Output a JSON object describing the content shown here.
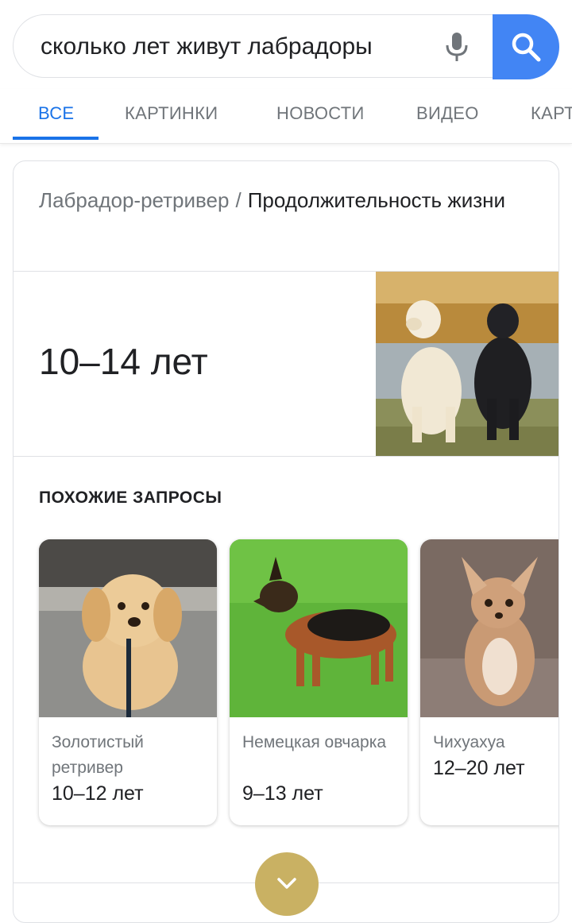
{
  "search": {
    "query": "сколько лет живут лабрадоры",
    "icons": {
      "mic": "mic-icon",
      "search": "search-icon"
    },
    "accent": "#4285f4"
  },
  "tabs": [
    {
      "label": "ВСЕ",
      "active": true
    },
    {
      "label": "КАРТИНКИ",
      "active": false
    },
    {
      "label": "НОВОСТИ",
      "active": false
    },
    {
      "label": "ВИДЕО",
      "active": false
    },
    {
      "label": "КАРТЫ",
      "active": false
    }
  ],
  "answer": {
    "breadcrumb_parent": "Лабрадор-ретривер",
    "breadcrumb_separator": "/",
    "breadcrumb_current": "Продолжительность жизни",
    "value": "10–14 лет",
    "image_alt": "labrador-photo"
  },
  "related": {
    "title": "ПОХОЖИЕ ЗАПРОСЫ",
    "items": [
      {
        "name": "Золотистый ретривер",
        "years": "10–12 лет"
      },
      {
        "name": "Немецкая овчарка",
        "years": "9–13 лет"
      },
      {
        "name": "Чихуахуа",
        "years": "12–20 лет"
      }
    ]
  },
  "colors": {
    "tab_active": "#1a73e8",
    "expand_button": "#c9b163"
  }
}
